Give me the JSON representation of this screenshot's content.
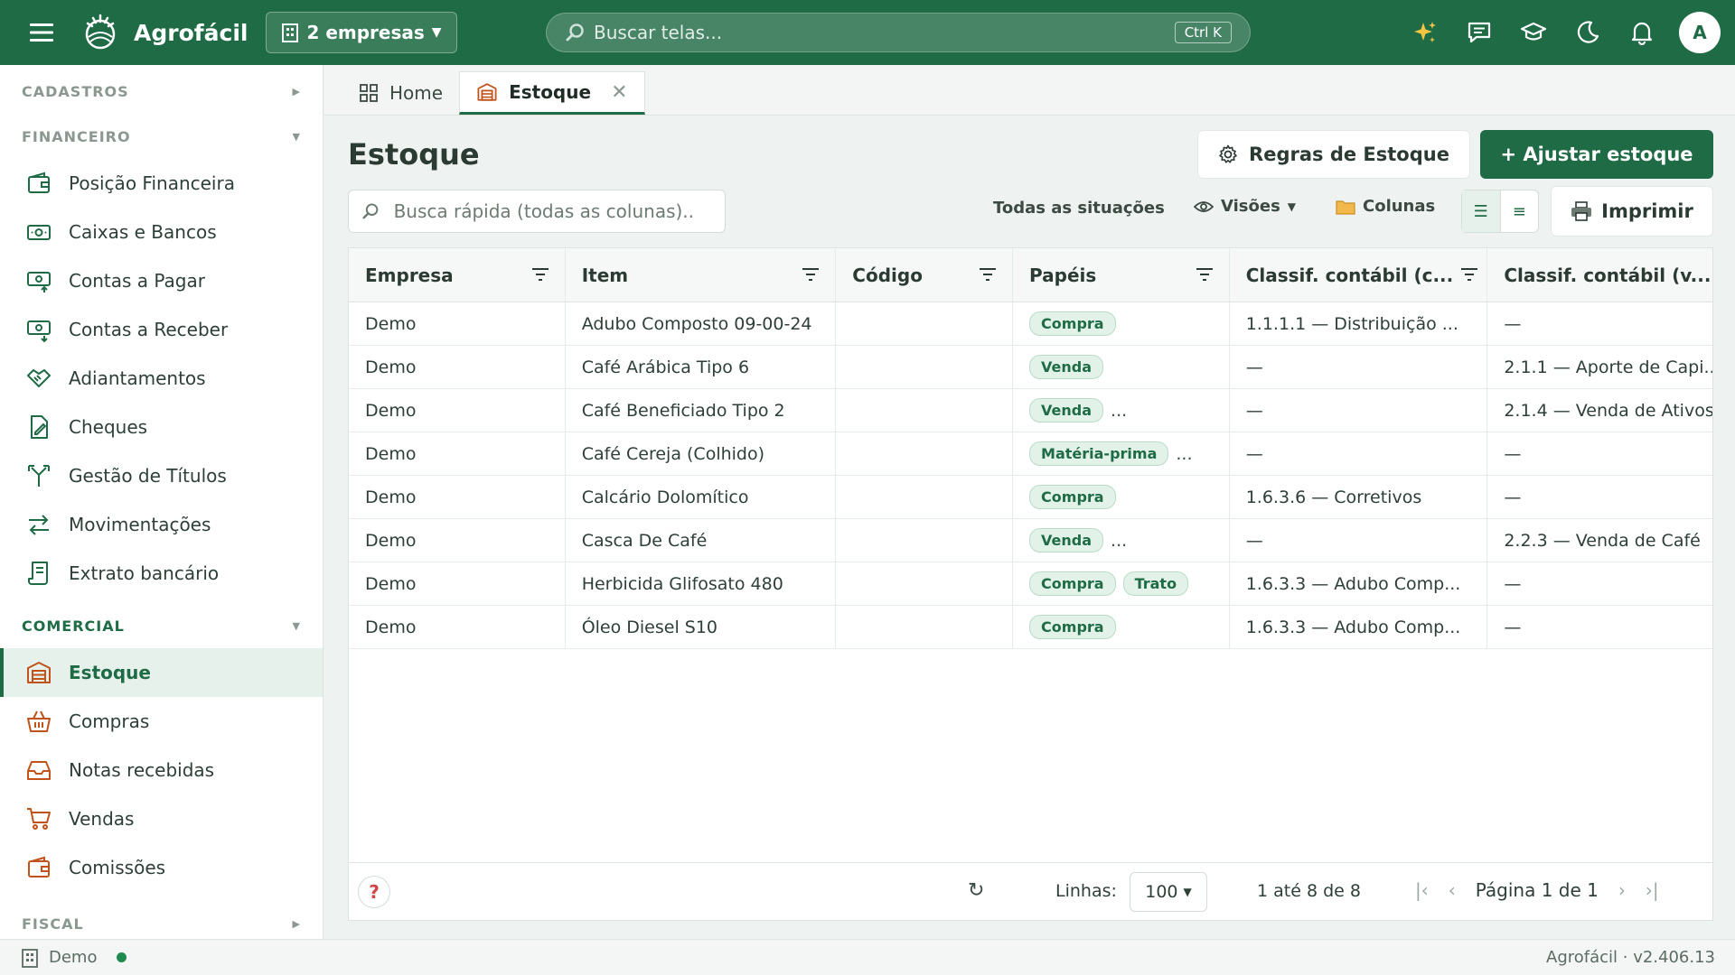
{
  "app": {
    "brand": "Agrofácil",
    "company_selector": "2 empresas",
    "search_placeholder": "Buscar telas...",
    "search_shortcut": "Ctrl K",
    "avatar_initial": "A"
  },
  "sidebar": {
    "sections": [
      {
        "title": "CADASTROS",
        "items": []
      },
      {
        "title": "FINANCEIRO",
        "items": [
          "Posição Financeira",
          "Caixas e Bancos",
          "Contas a Pagar",
          "Contas a Receber",
          "Adiantamentos",
          "Cheques",
          "Gestão de Títulos",
          "Movimentações",
          "Extrato bancário"
        ]
      },
      {
        "title": "COMERCIAL",
        "items": [
          "Estoque",
          "Compras",
          "Notas recebidas",
          "Vendas",
          "Comissões"
        ]
      },
      {
        "title": "FISCAL",
        "items": []
      }
    ]
  },
  "tabs": [
    {
      "label": "Home"
    },
    {
      "label": "Estoque"
    }
  ],
  "page": {
    "title": "Estoque",
    "rules_button": "Regras de Estoque",
    "adjust_button": "+ Ajustar estoque",
    "quick_search_placeholder": "Busca rápida (todas as colunas)..",
    "status_filter": "Todas as situações",
    "views_button": "Visões",
    "columns_button": "Colunas",
    "print_button": "Imprimir"
  },
  "grid": {
    "columns": [
      "Empresa",
      "Item",
      "Código",
      "Papéis",
      "Classif. contábil (c...",
      "Classif. contábil (v..."
    ],
    "rows": [
      {
        "empresa": "Demo",
        "item": "Adubo Composto 09-00-24",
        "codigo": "",
        "papeis": [
          "Compra"
        ],
        "more": "",
        "cc": "1.1.1.1 — Distribuição ...",
        "cv": "—"
      },
      {
        "empresa": "Demo",
        "item": "Café Arábica Tipo 6",
        "codigo": "",
        "papeis": [
          "Venda"
        ],
        "more": "",
        "cc": "—",
        "cv": "2.1.1 — Aporte de Capi..."
      },
      {
        "empresa": "Demo",
        "item": "Café Beneficiado Tipo 2",
        "codigo": "",
        "papeis": [
          "Venda"
        ],
        "more": "...",
        "cc": "—",
        "cv": "2.1.4 — Venda de Ativos"
      },
      {
        "empresa": "Demo",
        "item": "Café Cereja (Colhido)",
        "codigo": "",
        "papeis": [
          "Matéria-prima"
        ],
        "more": "...",
        "cc": "—",
        "cv": "—"
      },
      {
        "empresa": "Demo",
        "item": "Calcário Dolomítico",
        "codigo": "",
        "papeis": [
          "Compra"
        ],
        "more": "",
        "cc": "1.6.3.6 — Corretivos",
        "cv": "—"
      },
      {
        "empresa": "Demo",
        "item": "Casca De Café",
        "codigo": "",
        "papeis": [
          "Venda"
        ],
        "more": "...",
        "cc": "—",
        "cv": "2.2.3 — Venda de Café"
      },
      {
        "empresa": "Demo",
        "item": "Herbicida Glifosato 480",
        "codigo": "",
        "papeis": [
          "Compra",
          "Trato"
        ],
        "more": "",
        "cc": "1.6.3.3 — Adubo Comp...",
        "cv": "—"
      },
      {
        "empresa": "Demo",
        "item": "Óleo Diesel S10",
        "codigo": "",
        "papeis": [
          "Compra"
        ],
        "more": "",
        "cc": "1.6.3.3 — Adubo Comp...",
        "cv": "—"
      }
    ],
    "footer": {
      "help": "?",
      "rows_label": "Linhas:",
      "rows_value": "100",
      "range": "1 até 8 de 8",
      "page_label": "Página 1 de 1"
    }
  },
  "statusbar": {
    "company": "Demo",
    "version": "Agrofácil · v2.406.13"
  },
  "colors": {
    "brand": "#1f6b45",
    "accent_icon": "#c0521a"
  }
}
